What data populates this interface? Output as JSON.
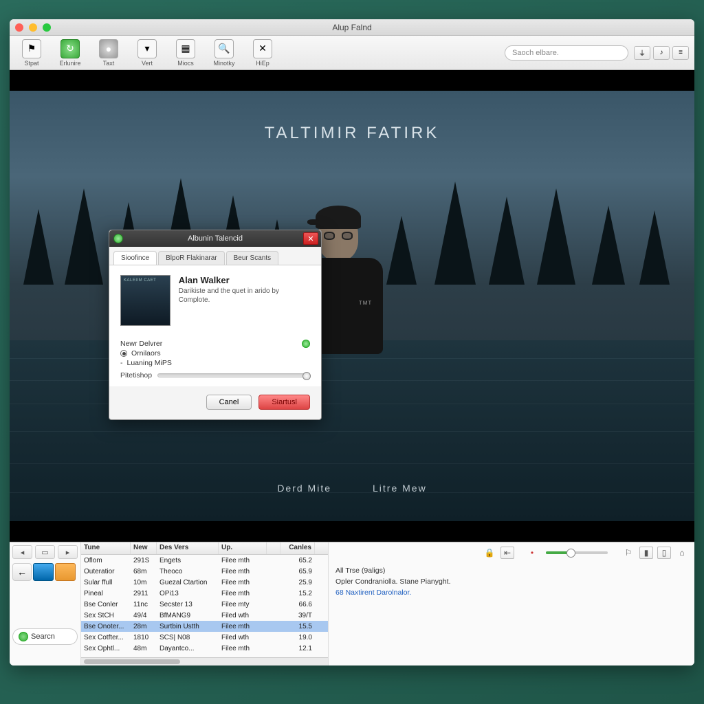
{
  "window": {
    "title": "Alup Falnd"
  },
  "toolbar": {
    "items": [
      {
        "label": "Stpat"
      },
      {
        "label": "Erlunire"
      },
      {
        "label": "Taxt"
      },
      {
        "label": "Vert"
      },
      {
        "label": "Miocs"
      },
      {
        "label": "Minotky"
      },
      {
        "label": "HiEp"
      }
    ],
    "search_placeholder": "Saoch elbare."
  },
  "artwork": {
    "title": "TALTIMIR FATIRK",
    "sub_left": "Derd Mite",
    "sub_right": "Litre Mew"
  },
  "dialog": {
    "title": "Albunin Talencid",
    "tabs": [
      {
        "label": "Sioofince"
      },
      {
        "label": "BlpoR Flakinarar"
      },
      {
        "label": "Beur Scants"
      }
    ],
    "thumb_text": "KALEIIM CAET",
    "artist": "Alan Walker",
    "desc": "Darikiste and the quet in arido by Complote.",
    "opt_heading": "Newr Delvrer",
    "opt_radio": "Ornilaors",
    "opt_item": "Luaning MiPS",
    "slider_label": "Pitetishop",
    "cancel": "Canel",
    "submit": "Siartusl"
  },
  "table": {
    "headers": [
      "Tune",
      "New",
      "Des Vers",
      "Up.",
      "",
      "Canles"
    ],
    "rows": [
      [
        "Oflom",
        "291S",
        "Engets",
        "Filee mth",
        "",
        "65.2"
      ],
      [
        "Outeratior",
        "68m",
        "Theoco",
        "Filee mth",
        "",
        "65.9"
      ],
      [
        "Sular ffull",
        "10m",
        "Guezal Ctartion",
        "Filee mth",
        "",
        "25.9"
      ],
      [
        "Pineal",
        "2911",
        "OPi13",
        "Filee mth",
        "",
        "15.2"
      ],
      [
        "Bse Conler",
        "11nc",
        "Secster 13",
        "Filee mty",
        "",
        "66.6"
      ],
      [
        "Sex StCH",
        "49/4",
        "BfMANG9",
        "Filed wth",
        "",
        "39/T"
      ],
      [
        "Bse Onoter...",
        "28m",
        "Surtbin Ustth",
        "Filee mth",
        "",
        "15.5"
      ],
      [
        "Sex Cotfter...",
        "1810",
        "SCS| N08",
        "Filed wth",
        "",
        "19.0"
      ],
      [
        "Sex Ophtl...",
        "48m",
        "Dayantco...",
        "Filee mth",
        "",
        "12.1"
      ]
    ],
    "selected_index": 6
  },
  "sidebar": {
    "search_label": "Searcn"
  },
  "info_pane": {
    "line1": "All Trse (9aligs)",
    "line2": "Opler Condraniolla. Stane Pianyght.",
    "line3": "68 Naxtirent Darolnalor."
  }
}
